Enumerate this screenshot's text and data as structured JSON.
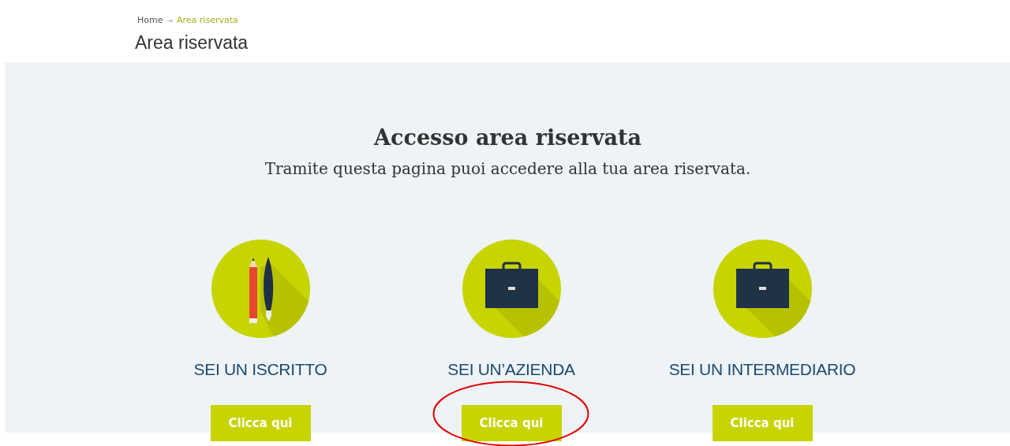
{
  "breadcrumb": [
    {
      "label": "Home",
      "selected": false
    },
    {
      "label": "Area riservata",
      "selected": true
    }
  ],
  "breadcrumb_separator": "→",
  "page_title": "Area riservata",
  "panel": {
    "heading": "Accesso area riservata",
    "subtitle": "Tramite questa pagina puoi accedere alla tua area riservata."
  },
  "cards": [
    {
      "kind": "pencil-pen",
      "title": "SEI UN ISCRITTO",
      "button": "Clicca qui",
      "highlighted": false
    },
    {
      "kind": "briefcase",
      "title": "SEI UN’AZIENDA",
      "button": "Clicca qui",
      "highlighted": true
    },
    {
      "kind": "briefcase",
      "title": "SEI UN INTERMEDIARIO",
      "button": "Clicca qui",
      "highlighted": false
    }
  ]
}
